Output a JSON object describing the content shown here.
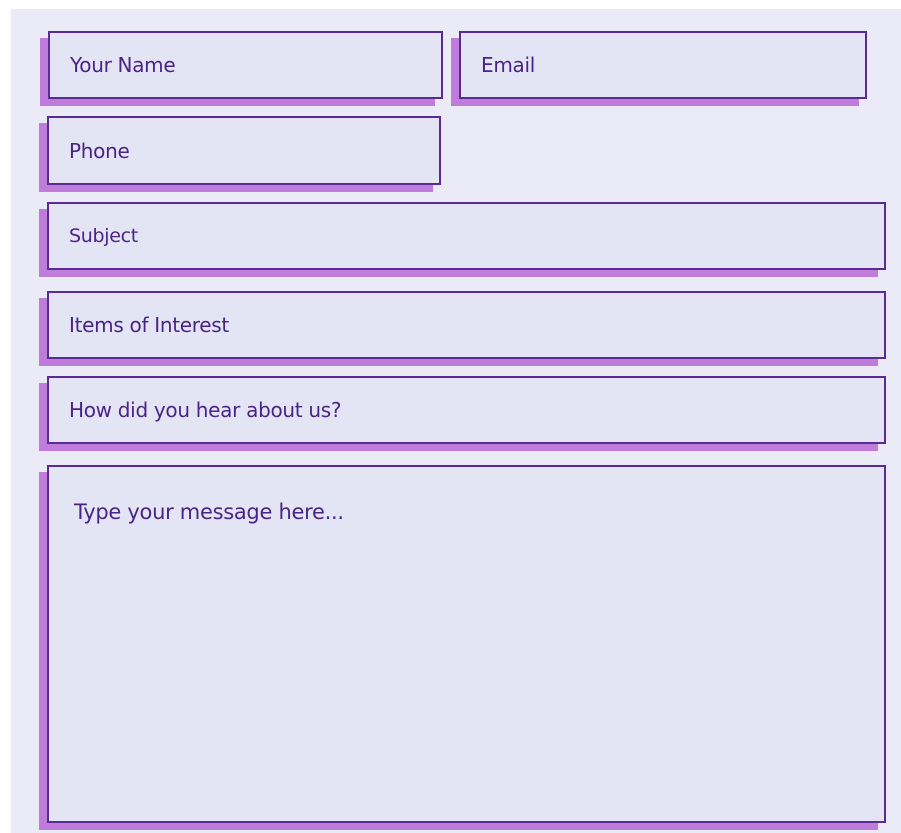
{
  "contact_form": {
    "name_placeholder": "Your Name",
    "email_placeholder": "Email",
    "phone_placeholder": "Phone",
    "subject_placeholder": "Subject",
    "items_of_interest_placeholder": "Items of Interest",
    "hear_about_placeholder": "How did you hear about us?",
    "message_placeholder": "Type your message here..."
  },
  "colors": {
    "panel_background": "#ebebf7",
    "field_background": "#e4e5f4",
    "field_border": "#5b2a96",
    "field_shadow": "#c07cdb",
    "placeholder_text": "#4a2484"
  }
}
